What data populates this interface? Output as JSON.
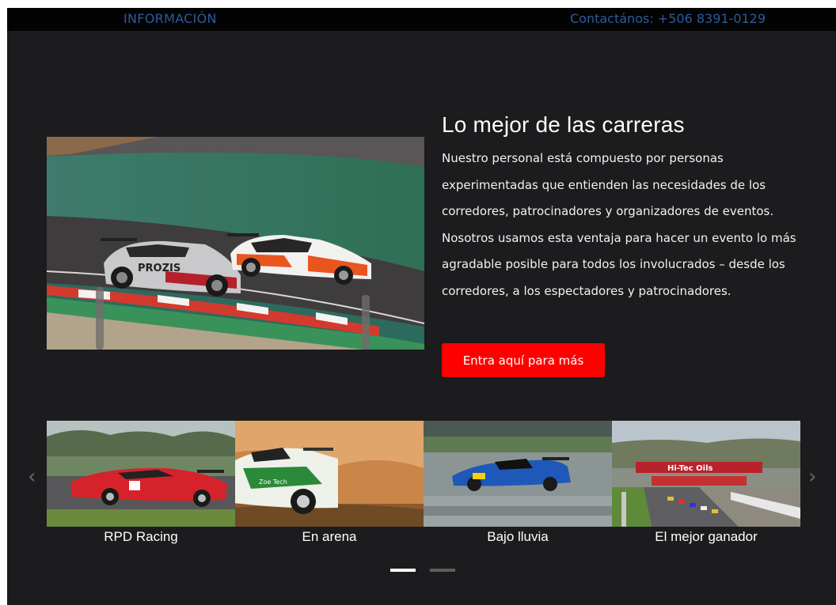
{
  "topbar": {
    "info_label": "INFORMACIÓN",
    "contact_label": "Contactános: +506 8391-0129",
    "link_color": "#2c5b9c"
  },
  "hero": {
    "title": "Lo mejor de las carreras",
    "body": "Nuestro personal está compuesto por personas experimentadas que entienden las necesidades de los corredores, patrocinadores y organizadores de eventos. Nosotros usamos esta ventaja para hacer un evento lo más agradable posible para todos los involucrados – desde los corredores, a los espectadores y patrocinadores.",
    "button_label": "Entra aquí para más",
    "button_color": "#ff0000",
    "image_icon": "race-cars-photo"
  },
  "carousel": {
    "prev_icon": "chevron-left-icon",
    "next_icon": "chevron-right-icon",
    "items": [
      {
        "caption": "RPD Racing",
        "icon": "red-race-car-photo"
      },
      {
        "caption": "En arena",
        "icon": "rally-car-photo"
      },
      {
        "caption": "Bajo lluvia",
        "icon": "blue-race-car-photo"
      },
      {
        "caption": "El mejor ganador",
        "icon": "race-track-crowd-photo"
      }
    ],
    "page_count": 2,
    "active_page": 1
  }
}
